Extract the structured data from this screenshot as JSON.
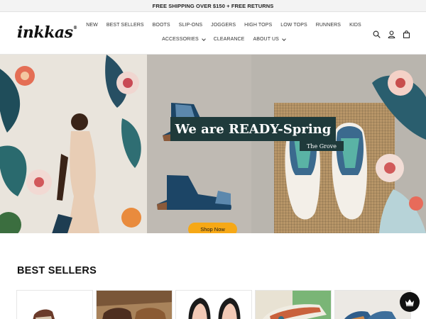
{
  "announcement": "FREE SHIPPING OVER $150 + FREE RETURNS",
  "brand": {
    "logo": "inkkas",
    "reg_mark": "®"
  },
  "nav": {
    "row1": [
      "NEW",
      "BEST SELLERS",
      "BOOTS",
      "SLIP-ONS",
      "JOGGERS",
      "HIGH TOPS",
      "LOW TOPS",
      "RUNNERS",
      "KIDS"
    ],
    "row2": [
      {
        "label": "ACCESSORIES",
        "dropdown": true
      },
      {
        "label": "CLEARANCE",
        "dropdown": false
      },
      {
        "label": "ABOUT US",
        "dropdown": true
      }
    ]
  },
  "header_icons": [
    "search-icon",
    "account-icon",
    "cart-icon"
  ],
  "hero": {
    "headline": "We are READY-Spring",
    "subheadline": "The Grove",
    "cta": "Shop Now",
    "slides_total": 3,
    "active_slide": 1
  },
  "best_sellers": {
    "title": "BEST SELLERS",
    "product_count_visible": 5
  },
  "colors": {
    "accent": "#f6a816",
    "headline_bg": "#1f3a3b",
    "announcement_bg": "#f3f3f3"
  }
}
